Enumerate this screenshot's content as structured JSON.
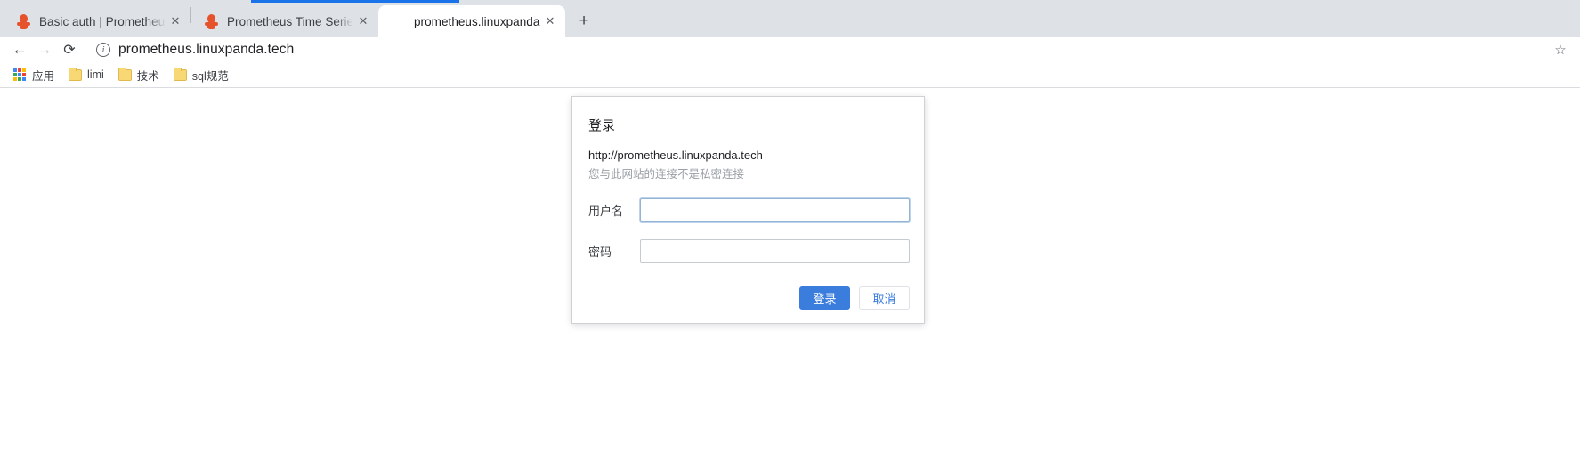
{
  "browser": {
    "tabs": [
      {
        "title": "Basic auth | Prometheus",
        "favicon": "prometheus-icon",
        "active": false,
        "close_label": "✕"
      },
      {
        "title": "Prometheus Time Series Colle",
        "favicon": "prometheus-icon",
        "active": false,
        "close_label": "✕"
      },
      {
        "title": "prometheus.linuxpanda.tech",
        "favicon": "none",
        "active": true,
        "close_label": "✕"
      }
    ],
    "newtab_label": "+",
    "toolbar": {
      "back_label": "←",
      "forward_label": "→",
      "reload_label": "⟳",
      "info_label": "i",
      "url": "prometheus.linuxpanda.tech",
      "star_label": "☆"
    },
    "bookmarks": [
      {
        "label": "应用",
        "icon": "apps-grid-icon"
      },
      {
        "label": "limi",
        "icon": "folder-icon"
      },
      {
        "label": "技术",
        "icon": "folder-icon"
      },
      {
        "label": "sql规范",
        "icon": "folder-icon"
      }
    ],
    "accent_color": "#1a73e8"
  },
  "dialog": {
    "title": "登录",
    "url": "http://prometheus.linuxpanda.tech",
    "warning": "您与此网站的连接不是私密连接",
    "fields": [
      {
        "label": "用户名",
        "value": "",
        "placeholder": "",
        "focused": true,
        "type": "text"
      },
      {
        "label": "密码",
        "value": "",
        "placeholder": "",
        "focused": false,
        "type": "password"
      }
    ],
    "submit_label": "登录",
    "cancel_label": "取消",
    "primary_color": "#3b7ddd"
  }
}
